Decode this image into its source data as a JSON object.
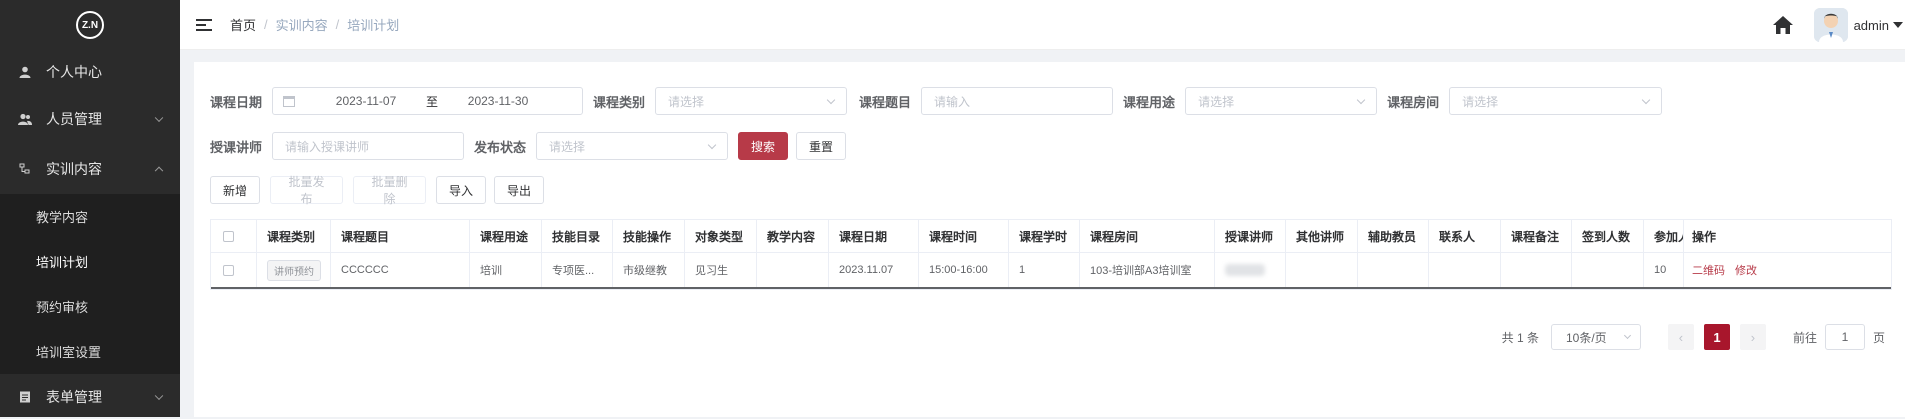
{
  "sidebar": {
    "logo_text": "Z.N",
    "items": [
      {
        "label": "个人中心",
        "icon": "user-icon"
      },
      {
        "label": "人员管理",
        "icon": "users-icon"
      },
      {
        "label": "实训内容",
        "icon": "tree-icon"
      },
      {
        "label": "表单管理",
        "icon": "form-icon"
      }
    ],
    "submenu": [
      {
        "label": "教学内容"
      },
      {
        "label": "培训计划"
      },
      {
        "label": "预约审核"
      },
      {
        "label": "培训室设置"
      }
    ]
  },
  "navbar": {
    "breadcrumb": [
      "首页",
      "实训内容",
      "培训计划"
    ],
    "separator": "/",
    "user_name": "admin"
  },
  "filters": {
    "course_date": {
      "label": "课程日期",
      "start": "2023-11-07",
      "end": "2023-11-30",
      "sep": "至"
    },
    "course_type": {
      "label": "课程类别",
      "placeholder": "请选择"
    },
    "course_title": {
      "label": "课程题目",
      "placeholder": "请输入"
    },
    "course_use": {
      "label": "课程用途",
      "placeholder": "请选择"
    },
    "course_room": {
      "label": "课程房间",
      "placeholder": "请选择"
    },
    "teacher": {
      "label": "授课讲师",
      "placeholder": "请输入授课讲师"
    },
    "publish_status": {
      "label": "发布状态",
      "placeholder": "请选择"
    },
    "search_btn": "搜索",
    "reset_btn": "重置"
  },
  "toolbar": {
    "add": "新增",
    "batch_publish": "批量发布",
    "batch_delete": "批量删除",
    "import": "导入",
    "export": "导出"
  },
  "table": {
    "headers": [
      "课程类别",
      "课程题目",
      "课程用途",
      "技能目录",
      "技能操作",
      "对象类型",
      "教学内容",
      "课程日期",
      "课程时间",
      "课程学时",
      "课程房间",
      "授课讲师",
      "其他讲师",
      "辅助教员",
      "联系人",
      "课程备注",
      "签到人数",
      "参加人",
      "操作"
    ],
    "rows": [
      {
        "type_tag": "讲师预约",
        "title": "CCCCCC",
        "use": "培训",
        "skill_dir": "专项医...",
        "skill_op": "市级继教",
        "target": "见习生",
        "content": "",
        "date": "2023.11.07",
        "time": "15:00-16:00",
        "hours": "1",
        "room": "103-培训部A3培训室",
        "other_teacher": "",
        "assistant": "",
        "contact": "",
        "remark": "",
        "signin": "",
        "participants": "10",
        "op_qr": "二维码",
        "op_edit": "修改"
      }
    ]
  },
  "pagination": {
    "total": "共 1 条",
    "page_size": "10条/页",
    "current_page": "1",
    "goto_label": "前往",
    "goto_value": "1",
    "page_unit": "页",
    "prev": "‹",
    "next": "›"
  },
  "colors": {
    "primary": "#b73a48",
    "sidebar_bg": "#2b2b2b",
    "submenu_bg": "#1f1f1f",
    "active_page": "#a8162c"
  }
}
